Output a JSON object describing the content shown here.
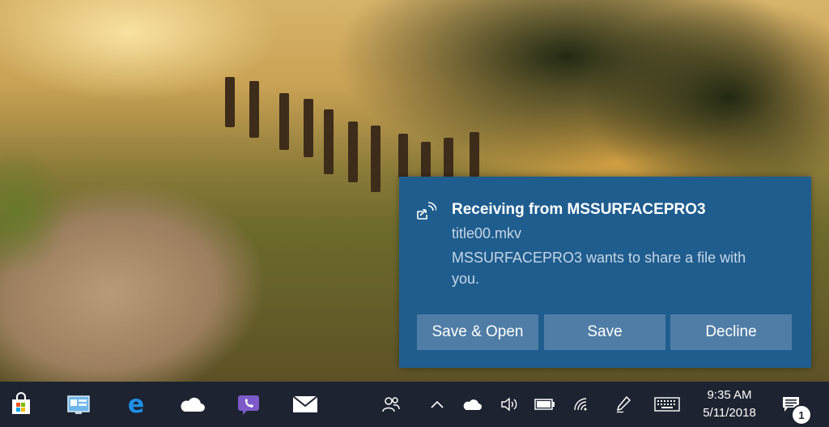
{
  "notification": {
    "title": "Receiving from MSSURFACEPRO3",
    "filename": "title00.mkv",
    "message": "MSSURFACEPRO3 wants to share a file with you.",
    "icon": "nearby-share-icon",
    "buttons": {
      "save_open": "Save & Open",
      "save": "Save",
      "decline": "Decline"
    }
  },
  "taskbar": {
    "apps": [
      {
        "name": "Microsoft Store",
        "icon": "store-icon"
      },
      {
        "name": "Control Panel",
        "icon": "control-panel-icon"
      },
      {
        "name": "Microsoft Edge",
        "icon": "edge-icon"
      },
      {
        "name": "OneDrive",
        "icon": "onedrive-icon"
      },
      {
        "name": "Viber",
        "icon": "viber-icon"
      },
      {
        "name": "Mail",
        "icon": "mail-icon"
      }
    ],
    "tray": {
      "icons": [
        "people-icon",
        "chevron-up-icon",
        "onedrive-tray-icon",
        "volume-icon",
        "battery-icon",
        "wifi-icon",
        "pen-icon",
        "keyboard-icon"
      ],
      "time": "9:35 AM",
      "date": "5/11/2018",
      "notification_count": "1"
    }
  },
  "colors": {
    "toast_bg": "#1f5d8e",
    "toast_button": "#4f7da6",
    "taskbar_bg": "#1d2330",
    "accent": "#0078d7"
  }
}
